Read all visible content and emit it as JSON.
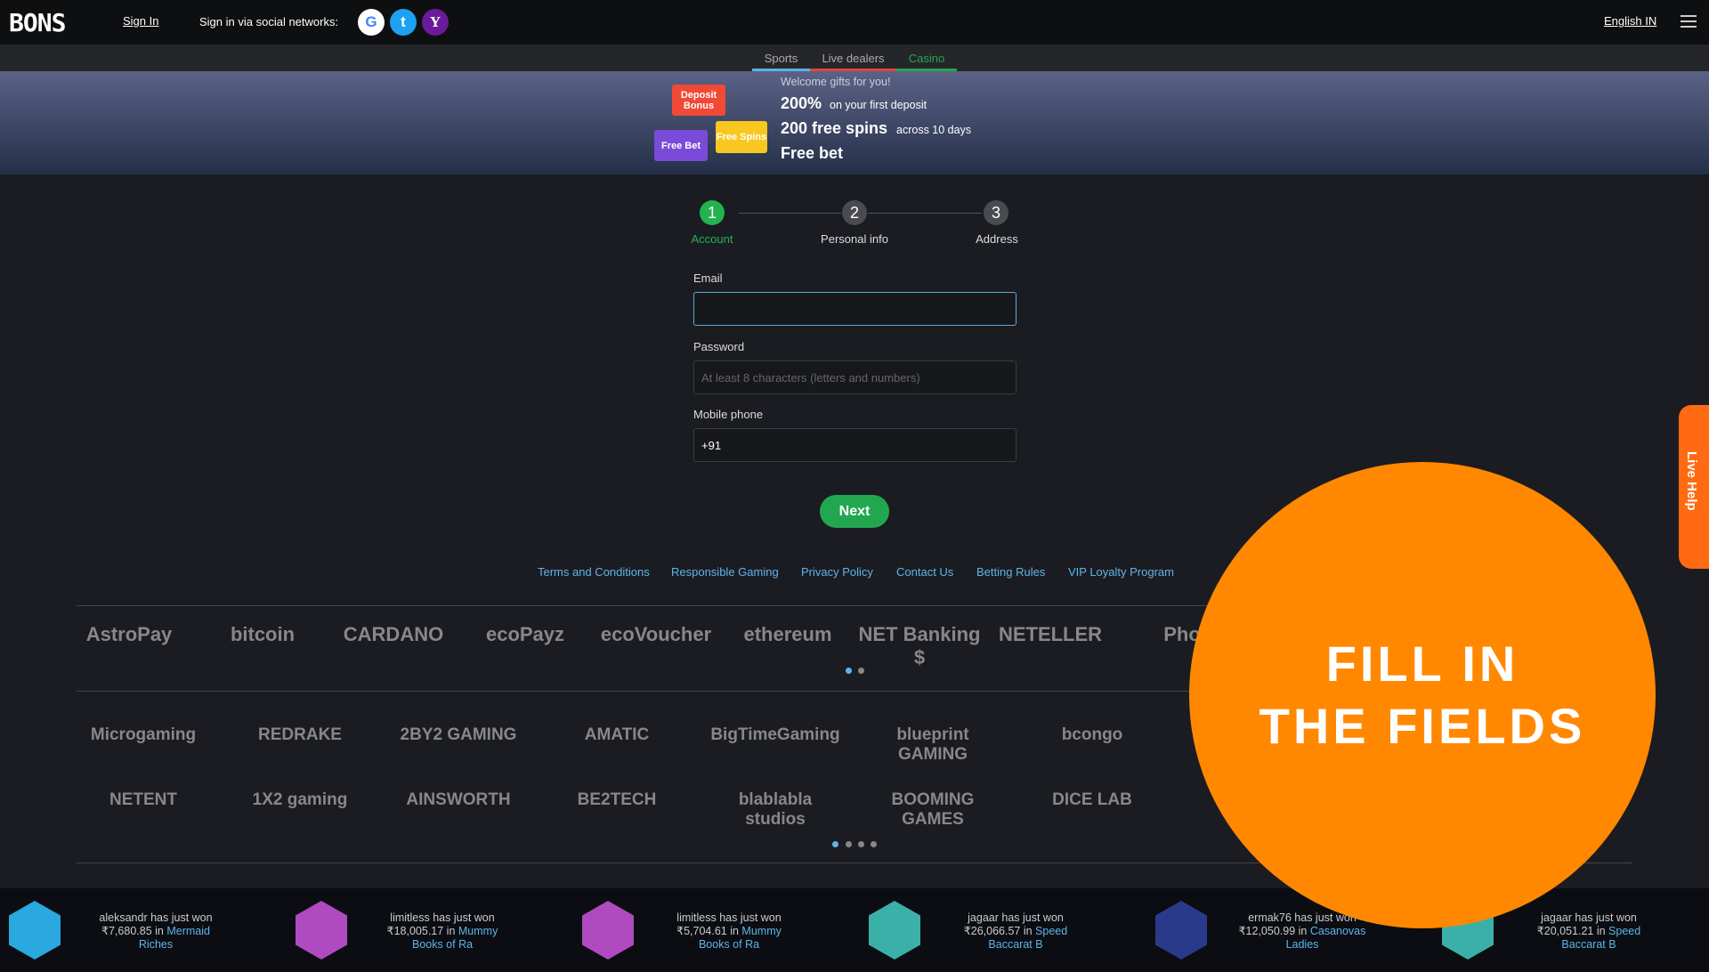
{
  "header": {
    "logo": "BONS",
    "sign_in": "Sign In",
    "social_label": "Sign in via social networks:",
    "social": [
      {
        "name": "Google",
        "glyph": "G",
        "color": "#ffffff"
      },
      {
        "name": "Twitter",
        "glyph": "t",
        "color": "#1da1f2"
      },
      {
        "name": "Yahoo",
        "glyph": "Y",
        "color": "#6a1b9a"
      }
    ],
    "language": "English IN"
  },
  "subnav": {
    "tabs": [
      {
        "label": "Sports",
        "color": "#5ab4e6"
      },
      {
        "label": "Live dealers",
        "color": "#e0443a"
      },
      {
        "label": "Casino",
        "color": "#22a750"
      }
    ],
    "active": "Casino"
  },
  "banner": {
    "badges": {
      "deposit": "Deposit Bonus",
      "free_bet": "Free Bet",
      "free_spins": "Free Spins"
    },
    "heading": "Welcome gifts for you!",
    "line1_big": "200%",
    "line1_small": "on your first deposit",
    "line2_big": "200 free spins",
    "line2_small": "across 10 days",
    "line3_big": "Free bet"
  },
  "stepper": {
    "steps": [
      {
        "n": "1",
        "label": "Account",
        "active": true
      },
      {
        "n": "2",
        "label": "Personal info"
      },
      {
        "n": "3",
        "label": "Address"
      }
    ]
  },
  "form": {
    "email_label": "Email",
    "email_value": "",
    "password_label": "Password",
    "password_placeholder": "At least 8 characters (letters and numbers)",
    "phone_label": "Mobile phone",
    "phone_value": "+91",
    "next": "Next"
  },
  "footer_links": [
    "Terms and Conditions",
    "Responsible Gaming",
    "Privacy Policy",
    "Contact Us",
    "Betting Rules",
    "VIP Loyalty Program"
  ],
  "payments": [
    "AstroPay",
    "bitcoin",
    "CARDANO",
    "ecoPayz",
    "ecoVoucher",
    "ethereum",
    "NET Banking $",
    "NETELLER",
    "Pho"
  ],
  "providers_row1": [
    "Microgaming",
    "REDRAKE",
    "2BY2 GAMING",
    "AMATIC",
    "BigTimeGaming",
    "blueprint GAMING",
    "bcongo"
  ],
  "providers_row2": [
    "NETENT",
    "1X2 gaming",
    "AINSWORTH",
    "BE2TECH",
    "blablabla studios",
    "BOOMING GAMES",
    "DICE LAB"
  ],
  "wins": [
    {
      "text": "aleksandr has just won ₹7,680.85 in",
      "game": "Mermaid Riches",
      "color": "#2aa8e0"
    },
    {
      "text": "limitless has just won ₹18,005.17 in",
      "game": "Mummy Books of Ra",
      "color": "#b04ac0"
    },
    {
      "text": "limitless has just won ₹5,704.61 in",
      "game": "Mummy Books of Ra",
      "color": "#b04ac0"
    },
    {
      "text": "jagaar has just won ₹26,066.57 in",
      "game": "Speed Baccarat B",
      "color": "#3bb0a8"
    },
    {
      "text": "ermak76 has just won ₹12,050.99 in",
      "game": "Casanovas Ladies",
      "color": "#2a3a8a"
    },
    {
      "text": "jagaar has just won ₹20,051.21 in",
      "game": "Speed Baccarat B",
      "color": "#3bb0a8"
    }
  ],
  "overlay": {
    "line1": "FILL IN",
    "line2": "THE FIELDS",
    "color": "#ff8800"
  },
  "live_help": "Live Help"
}
